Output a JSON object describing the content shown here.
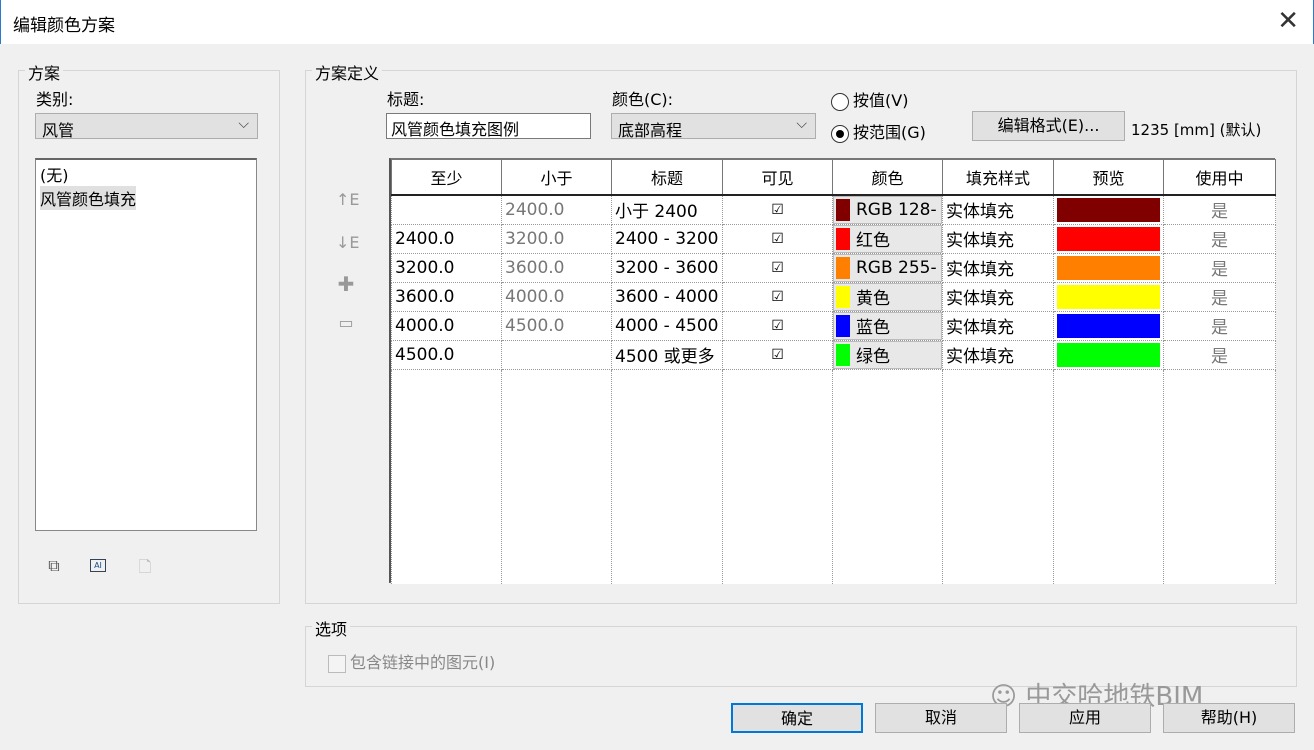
{
  "window": {
    "title": "编辑颜色方案",
    "close": "✕"
  },
  "schemes": {
    "group_label": "方案",
    "category_label": "类别:",
    "category_value": "风管",
    "items": [
      "(无)",
      "风管颜色填充"
    ]
  },
  "definition": {
    "group_label": "方案定义",
    "title_label": "标题:",
    "title_value": "风管颜色填充图例",
    "color_label": "颜色(C):",
    "color_value": "底部高程",
    "by_value": "按值(V)",
    "by_range": "按范围(G)",
    "edit_format": "编辑格式(E)...",
    "format_text": "1235 [mm] (默认)"
  },
  "table": {
    "headers": [
      "至少",
      "小于",
      "标题",
      "可见",
      "颜色",
      "填充样式",
      "预览",
      "使用中"
    ],
    "rows": [
      {
        "min": "",
        "less": "2400.0",
        "title": "小于 2400",
        "visible": "☑",
        "color_name": "RGB 128-",
        "color": "#800000",
        "fill": "实体填充",
        "in_use": "是"
      },
      {
        "min": "2400.0",
        "less": "3200.0",
        "title": "2400 - 3200",
        "visible": "☑",
        "color_name": "红色",
        "color": "#ff0000",
        "fill": "实体填充",
        "in_use": "是"
      },
      {
        "min": "3200.0",
        "less": "3600.0",
        "title": "3200 - 3600",
        "visible": "☑",
        "color_name": "RGB 255-",
        "color": "#ff8000",
        "fill": "实体填充",
        "in_use": "是"
      },
      {
        "min": "3600.0",
        "less": "4000.0",
        "title": "3600 - 4000",
        "visible": "☑",
        "color_name": "黄色",
        "color": "#ffff00",
        "fill": "实体填充",
        "in_use": "是"
      },
      {
        "min": "4000.0",
        "less": "4500.0",
        "title": "4000 - 4500",
        "visible": "☑",
        "color_name": "蓝色",
        "color": "#0000ff",
        "fill": "实体填充",
        "in_use": "是"
      },
      {
        "min": "4500.0",
        "less": "",
        "title": "4500 或更多",
        "visible": "☑",
        "color_name": "绿色",
        "color": "#00ff00",
        "fill": "实体填充",
        "in_use": "是"
      }
    ]
  },
  "options": {
    "group_label": "选项",
    "include_links": "包含链接中的图元(I)"
  },
  "buttons": {
    "ok": "确定",
    "cancel": "取消",
    "apply": "应用",
    "help": "帮助(H)"
  },
  "watermark": "中交哈地铁BIM"
}
